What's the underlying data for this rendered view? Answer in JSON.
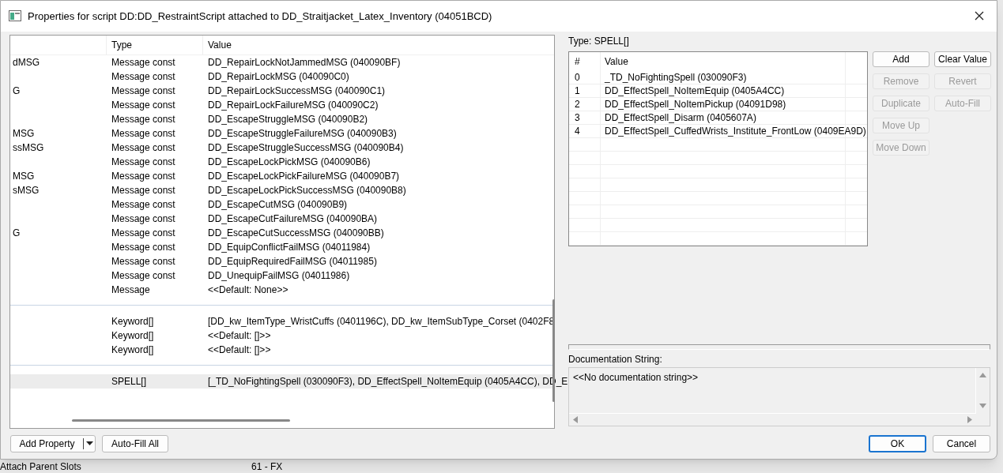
{
  "window": {
    "title": "Properties for script DD:DD_RestraintScript attached to DD_Straitjacket_Latex_Inventory (04051BCD)"
  },
  "properties": {
    "columns": [
      "Type",
      "Value"
    ],
    "groups": [
      {
        "rows": [
          {
            "name": "dMSG",
            "type": "Message const",
            "value": "DD_RepairLockNotJammedMSG (040090BF)",
            "selected": false
          },
          {
            "type": "Message const",
            "value": "DD_RepairLockMSG (040090C0)",
            "selected": false
          },
          {
            "name": "G",
            "type": "Message const",
            "value": "DD_RepairLockSuccessMSG (040090C1)",
            "selected": false
          },
          {
            "type": "Message const",
            "value": "DD_RepairLockFailureMSG (040090C2)",
            "selected": false
          },
          {
            "type": "Message const",
            "value": "DD_EscapeStruggleMSG (040090B2)",
            "selected": false
          },
          {
            "name": "MSG",
            "type": "Message const",
            "value": "DD_EscapeStruggleFailureMSG (040090B3)",
            "selected": false
          },
          {
            "name": "ssMSG",
            "type": "Message const",
            "value": "DD_EscapeStruggleSuccessMSG (040090B4)",
            "selected": false
          },
          {
            "type": "Message const",
            "value": "DD_EscapeLockPickMSG (040090B6)",
            "selected": false
          },
          {
            "name": "MSG",
            "type": "Message const",
            "value": "DD_EscapeLockPickFailureMSG (040090B7)",
            "selected": false
          },
          {
            "name": "sMSG",
            "type": "Message const",
            "value": "DD_EscapeLockPickSuccessMSG (040090B8)",
            "selected": false
          },
          {
            "type": "Message const",
            "value": "DD_EscapeCutMSG (040090B9)",
            "selected": false
          },
          {
            "type": "Message const",
            "value": "DD_EscapeCutFailureMSG (040090BA)",
            "selected": false
          },
          {
            "name": "G",
            "type": "Message const",
            "value": "DD_EscapeCutSuccessMSG (040090BB)",
            "selected": false
          },
          {
            "type": "Message const",
            "value": "DD_EquipConflictFailMSG (04011984)",
            "selected": false
          },
          {
            "type": "Message const",
            "value": "DD_EquipRequiredFailMSG (04011985)",
            "selected": false
          },
          {
            "type": "Message const",
            "value": "DD_UnequipFailMSG (04011986)",
            "selected": false
          },
          {
            "type": "Message",
            "value": "<<Default: None>>",
            "selected": false
          }
        ]
      },
      {
        "rows": [
          {
            "type": "Keyword[]",
            "value": "[DD_kw_ItemType_WristCuffs (0401196C), DD_kw_ItemSubType_Corset (0402F8",
            "selected": false
          },
          {
            "type": "Keyword[]",
            "value": "<<Default: []>>",
            "selected": false
          },
          {
            "type": "Keyword[]",
            "value": "<<Default: []>>",
            "selected": false
          }
        ]
      },
      {
        "rows": [
          {
            "type": "SPELL[]",
            "value": "[_TD_NoFightingSpell (030090F3), DD_EffectSpell_NoItemEquip (0405A4CC), DD_E",
            "selected": true
          }
        ]
      }
    ]
  },
  "type_label": "Type: SPELL[]",
  "array": {
    "columns": [
      "#",
      "Value"
    ],
    "rows": [
      {
        "index": "0",
        "value": "_TD_NoFightingSpell (030090F3)"
      },
      {
        "index": "1",
        "value": "DD_EffectSpell_NoItemEquip (0405A4CC)"
      },
      {
        "index": "2",
        "value": "DD_EffectSpell_NoItemPickup (04091D98)"
      },
      {
        "index": "3",
        "value": "DD_EffectSpell_Disarm (0405607A)"
      },
      {
        "index": "4",
        "value": "DD_EffectSpell_CuffedWrists_Institute_FrontLow (0409EA9D)"
      }
    ]
  },
  "array_buttons": [
    {
      "label": "Add",
      "disabled": false
    },
    {
      "label": "Clear Value",
      "disabled": false
    },
    {
      "label": "Remove",
      "disabled": true
    },
    {
      "label": "Revert",
      "disabled": true
    },
    {
      "label": "Duplicate",
      "disabled": true
    },
    {
      "label": "Auto-Fill",
      "disabled": true
    },
    {
      "label": "Move Up",
      "disabled": true
    },
    {
      "label": "Move Down",
      "disabled": true
    }
  ],
  "documentation": {
    "label": "Documentation String:",
    "text": "<<No documentation string>>"
  },
  "footer_left": [
    {
      "label": "Add Property",
      "kind": "split"
    },
    {
      "label": "Auto-Fill All",
      "kind": "plain"
    }
  ],
  "footer_right": [
    {
      "label": "OK",
      "default": true
    },
    {
      "label": "Cancel",
      "default": false
    }
  ],
  "background": {
    "texts": [
      "Attach Parent Slots",
      "61 - FX"
    ]
  }
}
